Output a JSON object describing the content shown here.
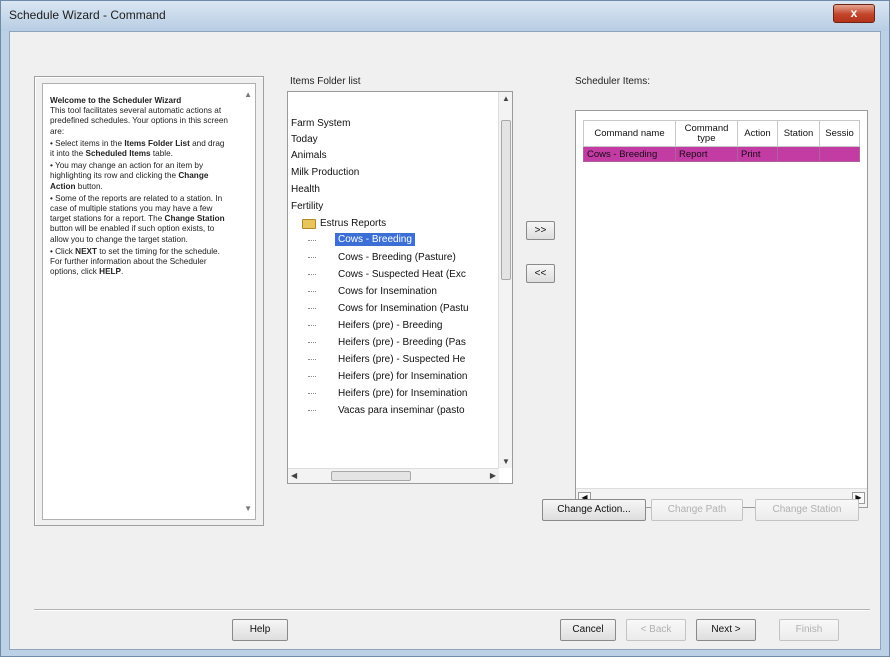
{
  "window": {
    "title": "Schedule Wizard - Command",
    "close_glyph": "x"
  },
  "welcome": {
    "heading": "Welcome to the Scheduler Wizard",
    "intro": "This tool facilitates several automatic actions at predefined schedules. Your options in this screen are:",
    "bullet1_pre": "•  Select items in the ",
    "bullet1_b1": "Items Folder List",
    "bullet1_mid": " and drag it into the ",
    "bullet1_b2": "Scheduled Items",
    "bullet1_post": " table.",
    "bullet2_pre": "•  You may change an action for an item by highlighting its row and clicking the ",
    "bullet2_b": "Change Action",
    "bullet2_post": " button.",
    "bullet3_pre": "•  Some of the reports are related to a station. In case of multiple stations you may have a few target stations for a report. The ",
    "bullet3_b": "Change Station",
    "bullet3_post": " button will be enabled if such option exists, to allow you to change the target station.",
    "bullet4_pre": "•  Click ",
    "bullet4_b": "NEXT",
    "bullet4_mid": " to set the timing for the schedule. For further information about the Scheduler options, click ",
    "bullet4_b2": "HELP",
    "bullet4_post": "."
  },
  "items_folder": {
    "label": "Items Folder list",
    "root_items": [
      "Farm System",
      "Today",
      "Animals",
      "Milk Production",
      "Health",
      "Fertility",
      "Estrus Reports"
    ],
    "children": [
      "Cows - Breeding",
      "Cows - Breeding (Pasture)",
      "Cows - Suspected Heat (Exc",
      "Cows for Insemination",
      "Cows for Insemination (Pastu",
      "Heifers (pre) - Breeding",
      "Heifers (pre) - Breeding (Pas",
      "Heifers (pre) - Suspected He",
      "Heifers (pre) for Insemination",
      "Heifers (pre) for Insemination",
      "Vacas para inseminar (pasto"
    ],
    "selected_index": 0
  },
  "transfer": {
    "add_label": ">>",
    "remove_label": "<<"
  },
  "scheduler": {
    "label": "Scheduler Items:",
    "columns": [
      "Command name",
      "Command type",
      "Action",
      "Station",
      "Sessio"
    ],
    "rows": [
      {
        "command_name": "Cows - Breeding",
        "command_type": "Report",
        "action": "Print",
        "station": "",
        "session": ""
      }
    ],
    "highlight_color": "#c23ca3"
  },
  "action_buttons": {
    "change_action": "Change Action...",
    "change_path": "Change Path",
    "change_station": "Change Station"
  },
  "footer": {
    "help": "Help",
    "cancel": "Cancel",
    "back": "< Back",
    "next": "Next >",
    "finish": "Finish"
  }
}
